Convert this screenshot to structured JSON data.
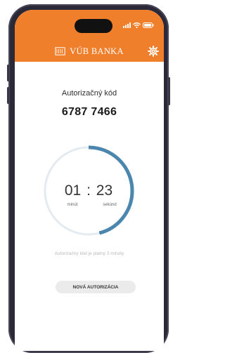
{
  "app": {
    "brand": "VÚB BANKA"
  },
  "main": {
    "title": "Autorizačný kód",
    "code": "6787 7466",
    "timer": {
      "minutes": "01",
      "separator": ":",
      "seconds": "23",
      "minutes_label": "minút",
      "seconds_label": "sekúnd",
      "remaining_fraction": 0.46
    },
    "validity_note": "Autorizačný kód je platný 3 minúty",
    "new_authorization_label": "NOVÁ AUTORIZÁCIA"
  },
  "colors": {
    "brand_orange": "#f07f2c",
    "timer_blue": "#4a86ad",
    "timer_track": "#e4ebf0"
  },
  "icons": {
    "settings": "gear-icon",
    "logo": "vub-logo-icon",
    "signal": "signal-icon",
    "wifi": "wifi-icon",
    "battery": "battery-icon"
  }
}
